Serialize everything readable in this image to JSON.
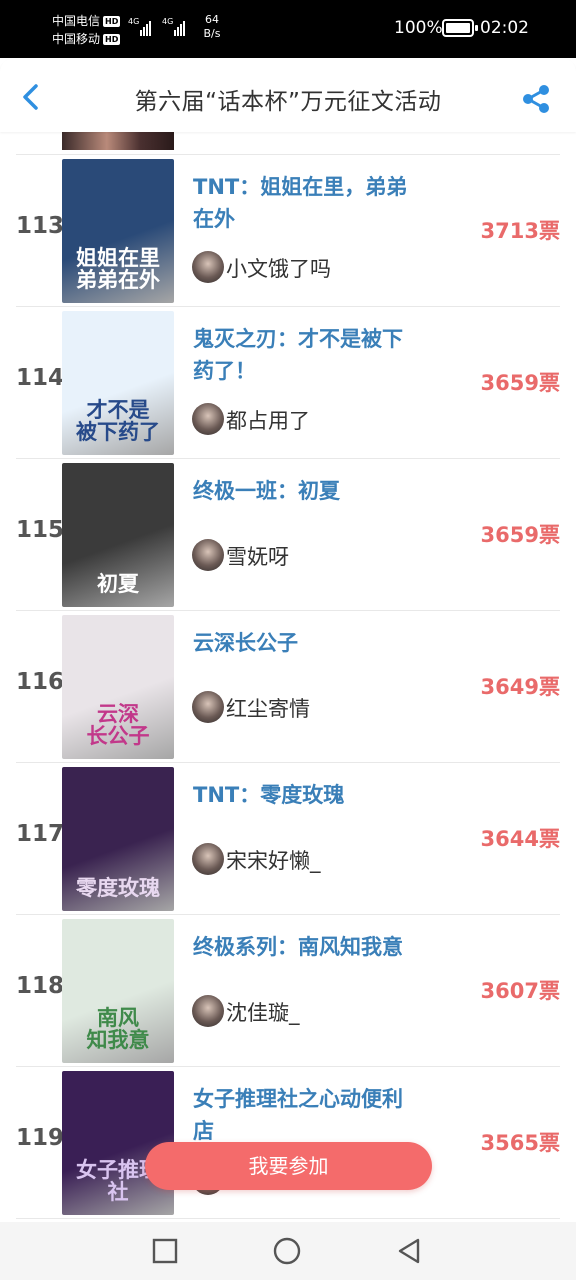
{
  "status_bar": {
    "carrier1": "中国电信",
    "carrier2": "中国移动",
    "hd_badge": "HD",
    "net_type": "4G",
    "speed_value": "64",
    "speed_unit": "B/s",
    "battery_pct": "100%",
    "time": "02:02"
  },
  "header": {
    "title": "第六届“话本杯”万元征文活动",
    "back_icon": "chevron-left-icon",
    "share_icon": "share-icon",
    "accent": "#2f8fe0"
  },
  "rows": [
    {
      "rank": "113",
      "title": "TNT：姐姐在里，弟弟在外",
      "author": "小文饿了吗",
      "votes": "3713票",
      "cover_text": "姐姐在里\n弟弟在外",
      "cover_bg": "#2a4a78",
      "cover_fg": "#ffffff"
    },
    {
      "rank": "114",
      "title": "鬼灭之刃：才不是被下药了！",
      "author": "都占用了",
      "votes": "3659票",
      "cover_text": "才不是\n被下药了",
      "cover_bg": "#e8f2fb",
      "cover_fg": "#274a8a"
    },
    {
      "rank": "115",
      "title": "终极一班：初夏",
      "author": "雪妩呀",
      "votes": "3659票",
      "cover_text": "初夏",
      "cover_bg": "#3b3b3b",
      "cover_fg": "#ffffff"
    },
    {
      "rank": "116",
      "title": "云深长公子",
      "author": "红尘寄情",
      "votes": "3649票",
      "cover_text": "云深\n长公子",
      "cover_bg": "#e9e4e8",
      "cover_fg": "#c2388a"
    },
    {
      "rank": "117",
      "title": "TNT：零度玫瑰",
      "author": "宋宋好懒_",
      "votes": "3644票",
      "cover_text": "零度玫瑰",
      "cover_bg": "#3a2350",
      "cover_fg": "#e8d8f0"
    },
    {
      "rank": "118",
      "title": "终极系列：南风知我意",
      "author": "沈佳璇_",
      "votes": "3607票",
      "cover_text": "南风\n知我意",
      "cover_bg": "#dfe9e0",
      "cover_fg": "#3f8a4a"
    },
    {
      "rank": "119",
      "title": "女子推理社之心动便利店",
      "author": "",
      "votes": "3565票",
      "cover_text": "女子推理社",
      "cover_bg": "#3a1f55",
      "cover_fg": "#d9c4f0"
    }
  ],
  "join_button": {
    "label": "我要参加",
    "color": "#f46b6b"
  },
  "nav": {
    "recents_icon": "square-icon",
    "home_icon": "circle-icon",
    "back_icon": "triangle-back-icon"
  },
  "colors": {
    "title_blue": "#3a7fb8",
    "votes_red": "#e96a6a"
  }
}
